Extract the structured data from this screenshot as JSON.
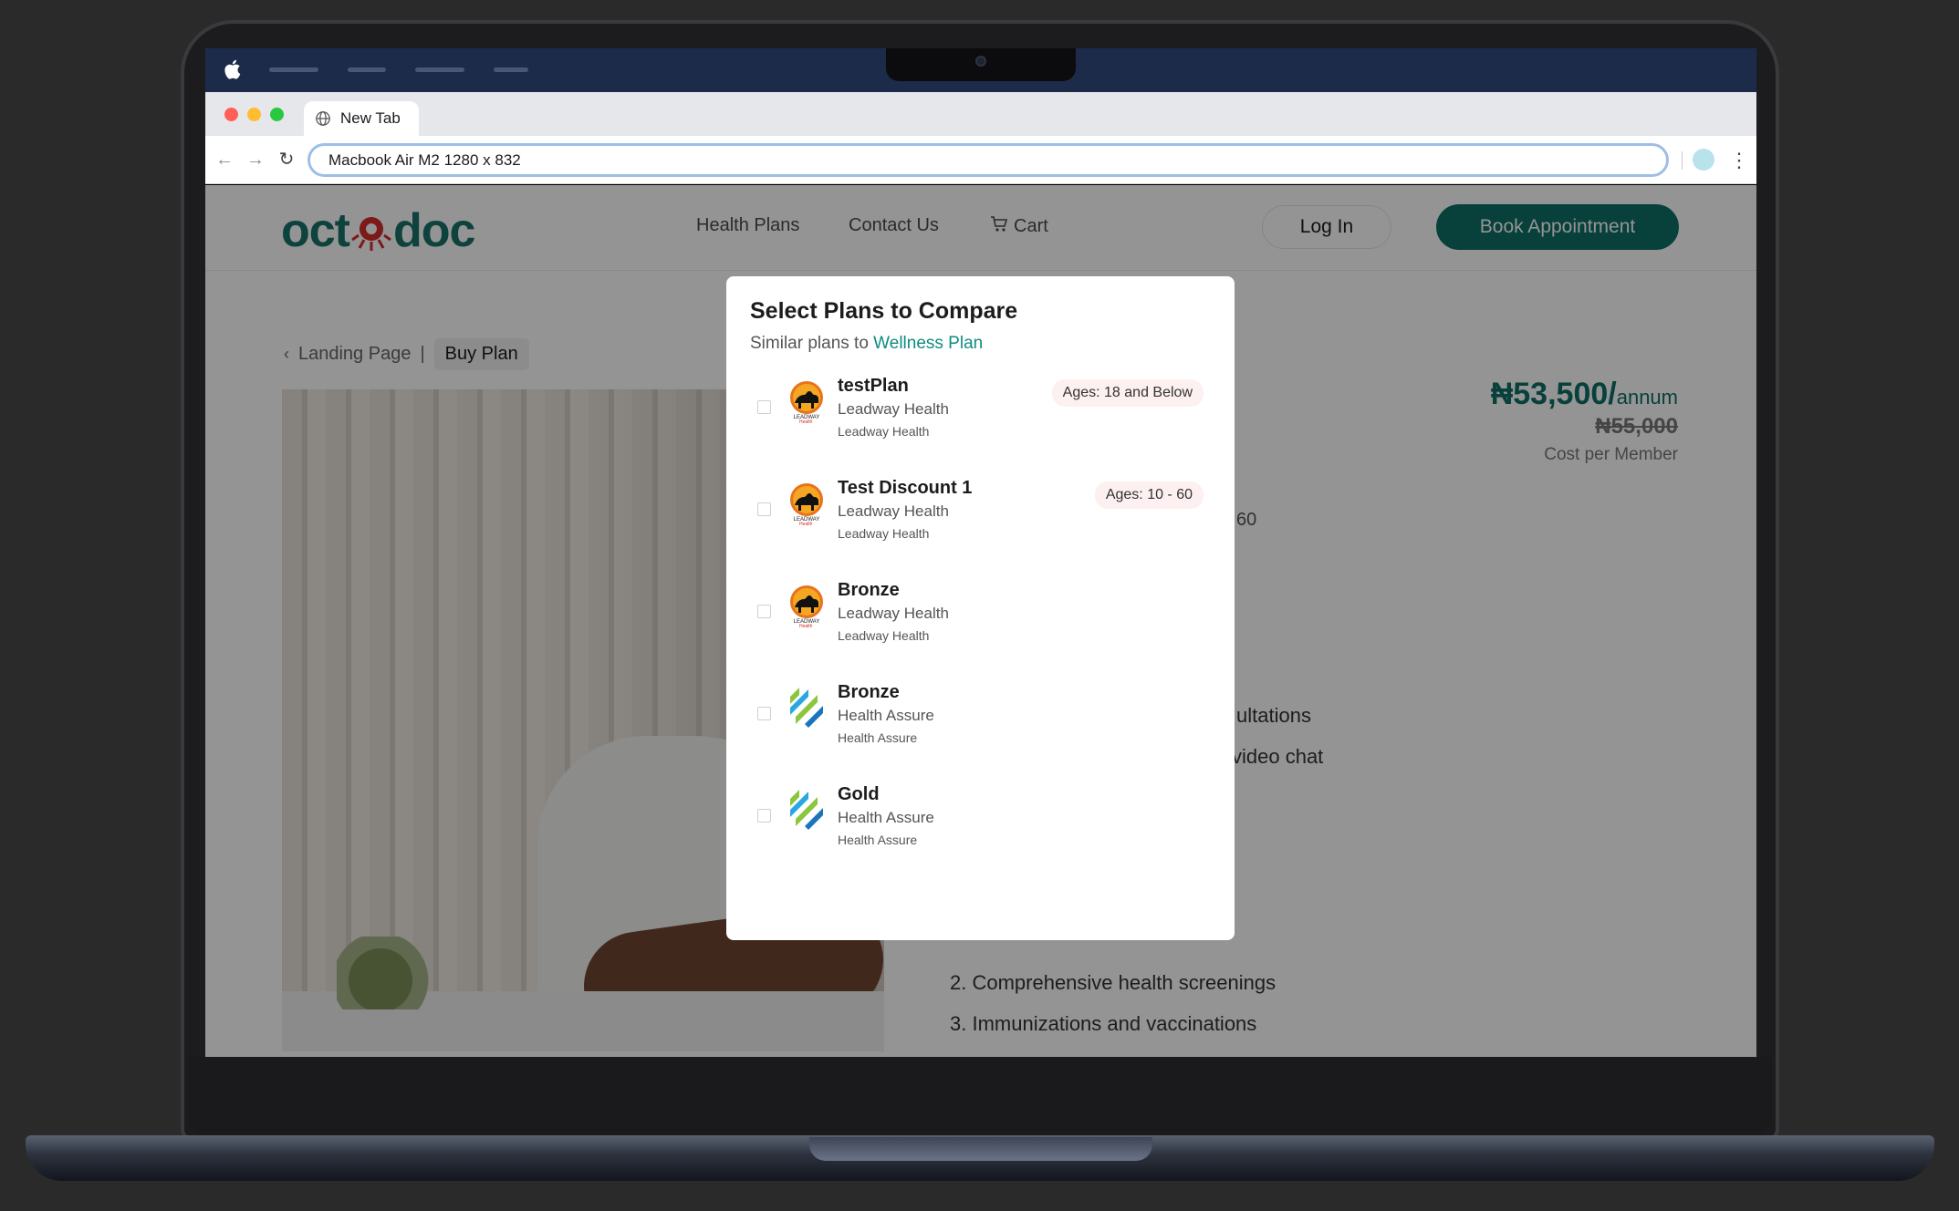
{
  "browser": {
    "tab_title": "New Tab",
    "address": "Macbook Air M2  1280 x 832"
  },
  "site": {
    "logo_text_left": "oct",
    "logo_text_right": "doc",
    "nav": [
      "Health Plans",
      "Contact Us",
      "Cart"
    ],
    "login_label": "Log In",
    "book_label": "Book Appointment"
  },
  "breadcrumb": {
    "parent": "Landing Page",
    "separator": "|",
    "current": "Buy Plan"
  },
  "price": {
    "amount": "₦53,500/",
    "unit": "annum",
    "old": "₦55,000",
    "note": "Cost per Member"
  },
  "details_visible": {
    "ages_fragment": "60",
    "line_consult": "ultations",
    "line_video": "video chat",
    "line_2": "2. Comprehensive health screenings",
    "line_3": "3. Immunizations and vaccinations"
  },
  "modal": {
    "title": "Select Plans to Compare",
    "subtitle_prefix": "Similar plans to ",
    "subtitle_plan": "Wellness Plan",
    "plans": [
      {
        "name": "testPlan",
        "provider": "Leadway Health",
        "provider_sub": "Leadway Health",
        "badge": "Ages: 18 and Below",
        "logo": "leadway-icon",
        "checked": false
      },
      {
        "name": "Test Discount 1",
        "provider": "Leadway Health",
        "provider_sub": "Leadway Health",
        "badge": "Ages: 10 - 60",
        "logo": "leadway-icon",
        "checked": false
      },
      {
        "name": "Bronze",
        "provider": "Leadway Health",
        "provider_sub": "Leadway Health",
        "badge": "",
        "logo": "leadway-icon",
        "checked": false
      },
      {
        "name": "Bronze",
        "provider": "Health Assure",
        "provider_sub": "Health Assure",
        "badge": "",
        "logo": "health-assure-icon",
        "checked": false
      },
      {
        "name": "Gold",
        "provider": "Health Assure",
        "provider_sub": "Health Assure",
        "badge": "",
        "logo": "health-assure-icon",
        "checked": false
      }
    ]
  },
  "colors": {
    "brand_teal": "#0f6e66",
    "accent_link": "#0f8c80",
    "logo_red": "#d62b2b",
    "badge_bg": "#fdf0f1"
  }
}
